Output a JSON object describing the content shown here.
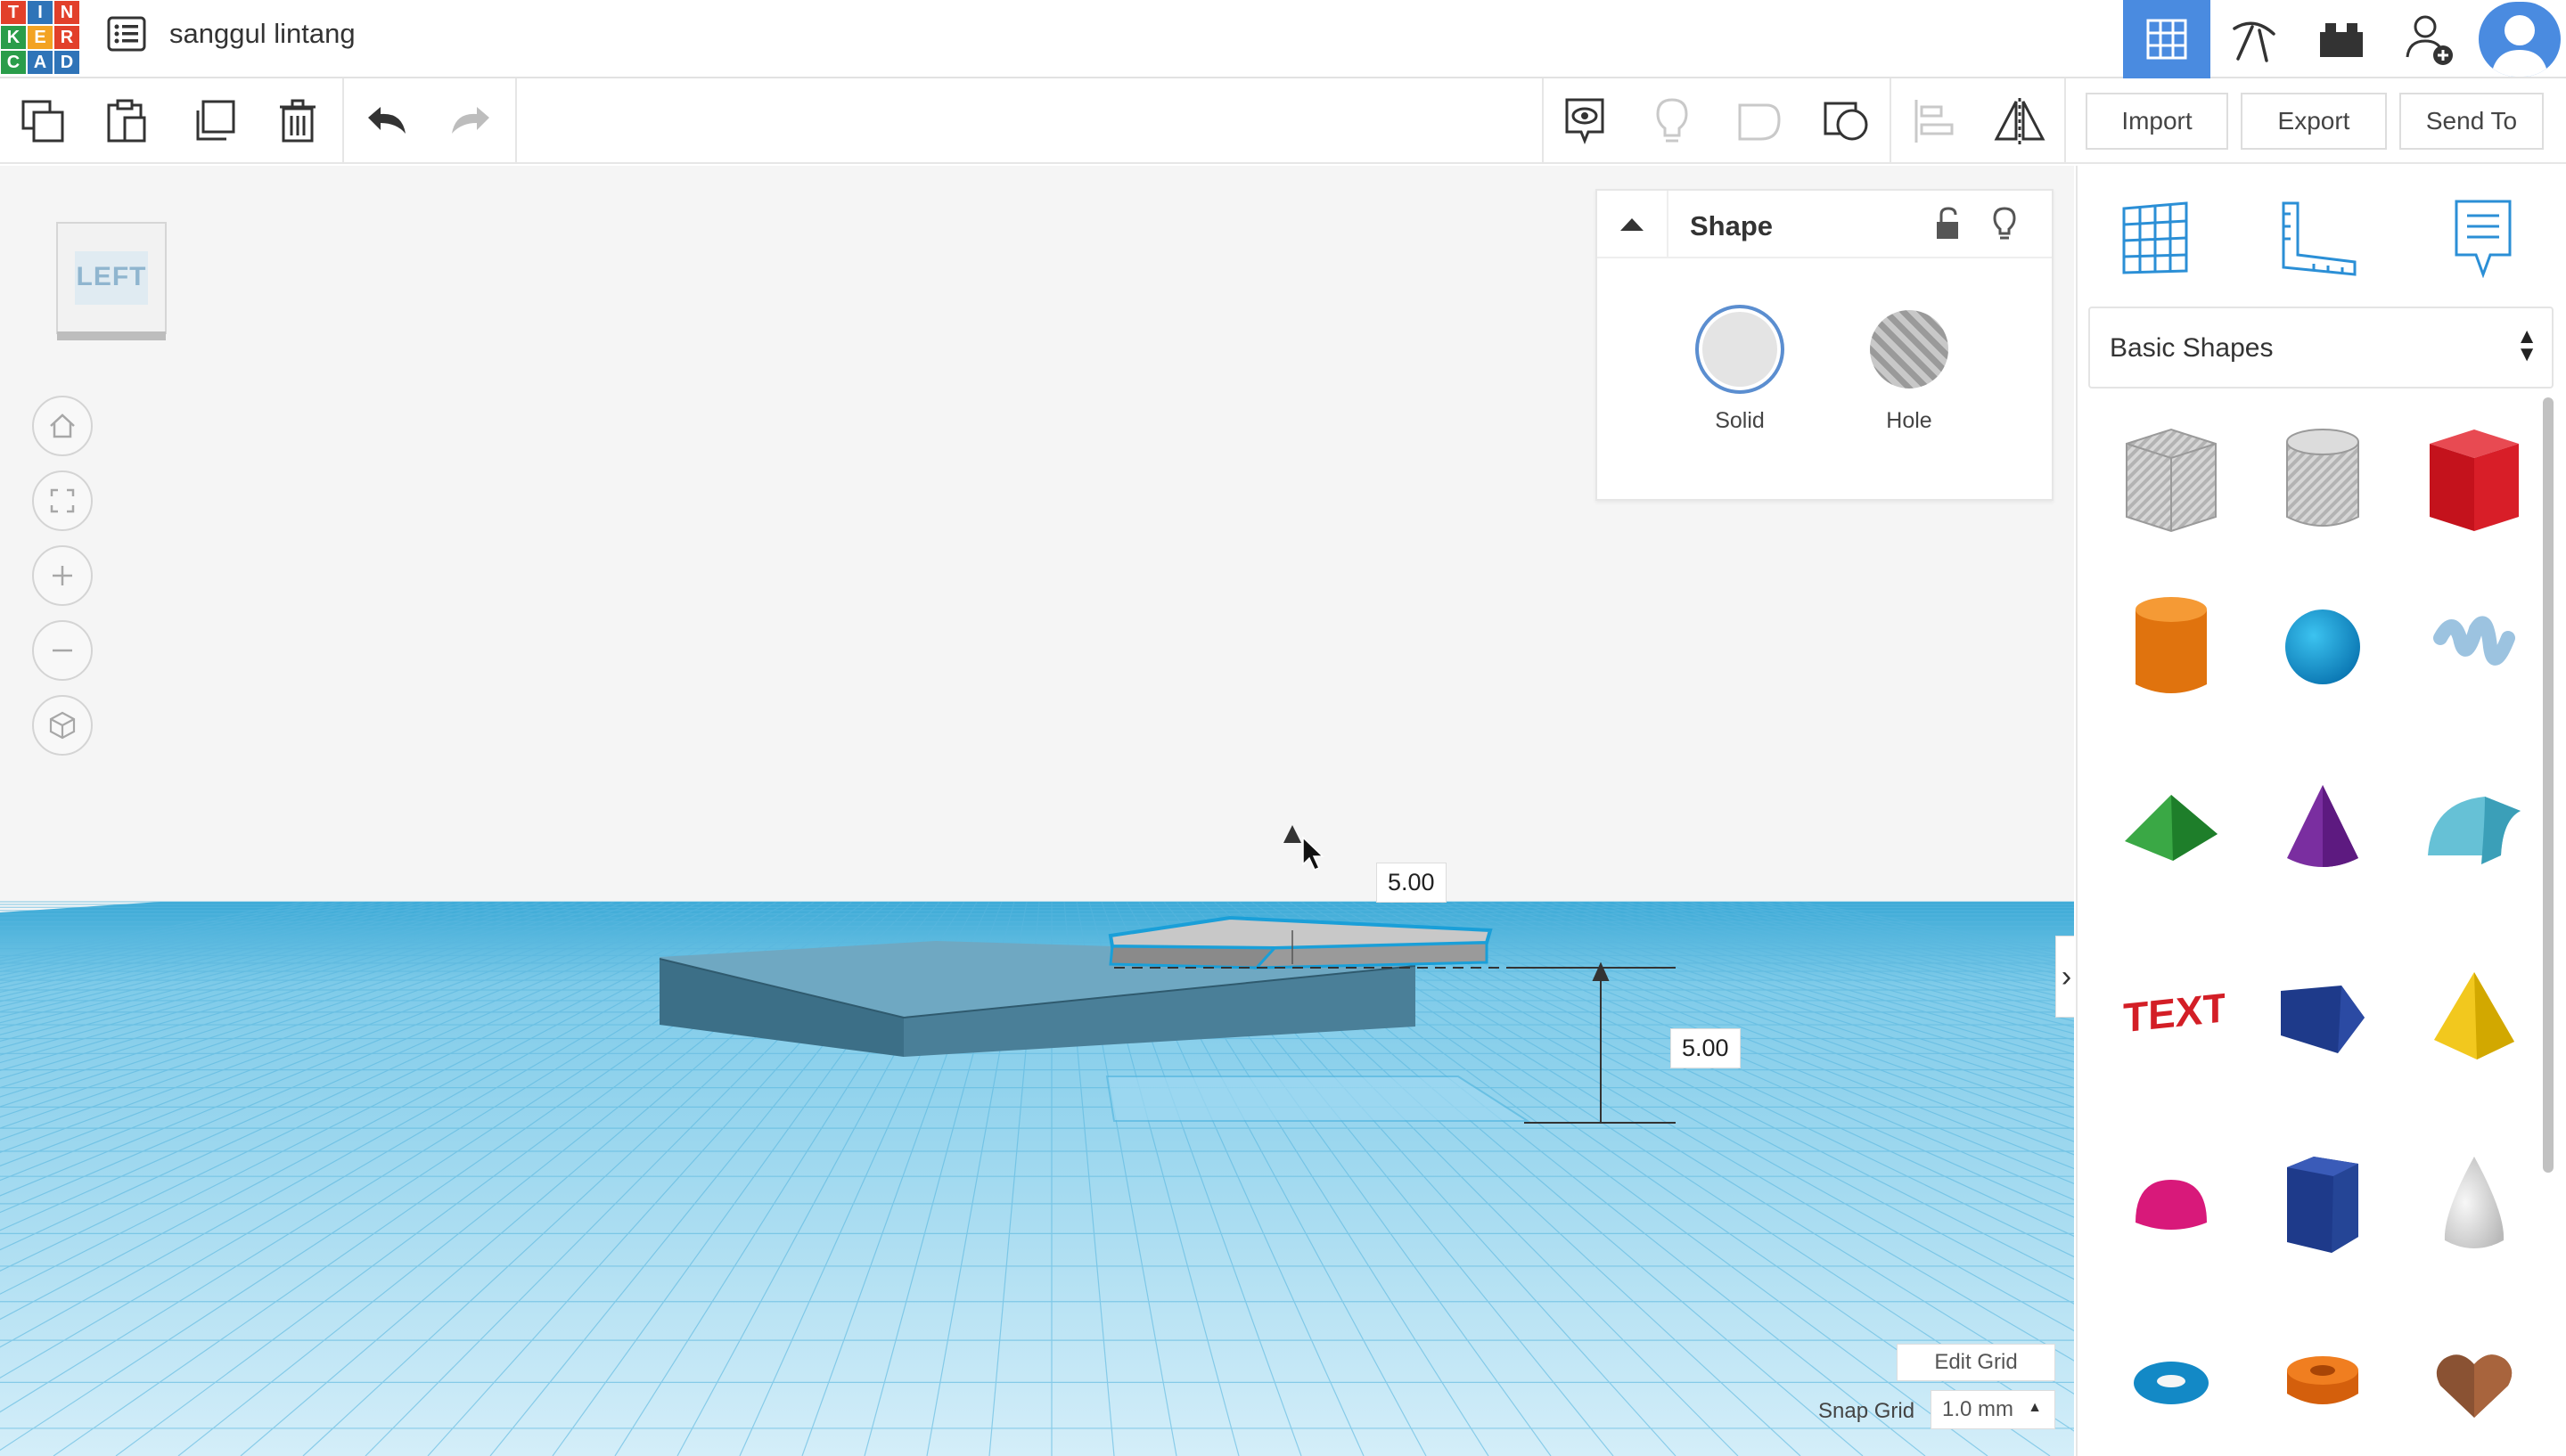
{
  "header": {
    "logo_letters": [
      "T",
      "I",
      "N",
      "K",
      "E",
      "R",
      "C",
      "A",
      "D"
    ],
    "design_title": "sanggul lintang"
  },
  "toolbar": {
    "import_label": "Import",
    "export_label": "Export",
    "send_to_label": "Send To"
  },
  "viewcube": {
    "face_label": "LEFT"
  },
  "dimensions": {
    "top_value": "5.00",
    "height_value": "5.00"
  },
  "shape_panel": {
    "title": "Shape",
    "solid_label": "Solid",
    "hole_label": "Hole"
  },
  "grid": {
    "edit_label": "Edit Grid",
    "snap_label": "Snap Grid",
    "snap_value": "1.0 mm"
  },
  "library": {
    "category": "Basic Shapes",
    "shapes": [
      "box-hole",
      "cylinder-hole",
      "box",
      "cylinder",
      "sphere",
      "scribble",
      "roof",
      "cone",
      "round-roof",
      "text",
      "wedge",
      "pyramid",
      "half-sphere",
      "polygon",
      "paraboloid",
      "torus",
      "tube",
      "heart"
    ]
  },
  "colors": {
    "accent": "#4a8be0",
    "grid_blue": "#69c3e8",
    "selected_outline": "#1a9fd8"
  }
}
